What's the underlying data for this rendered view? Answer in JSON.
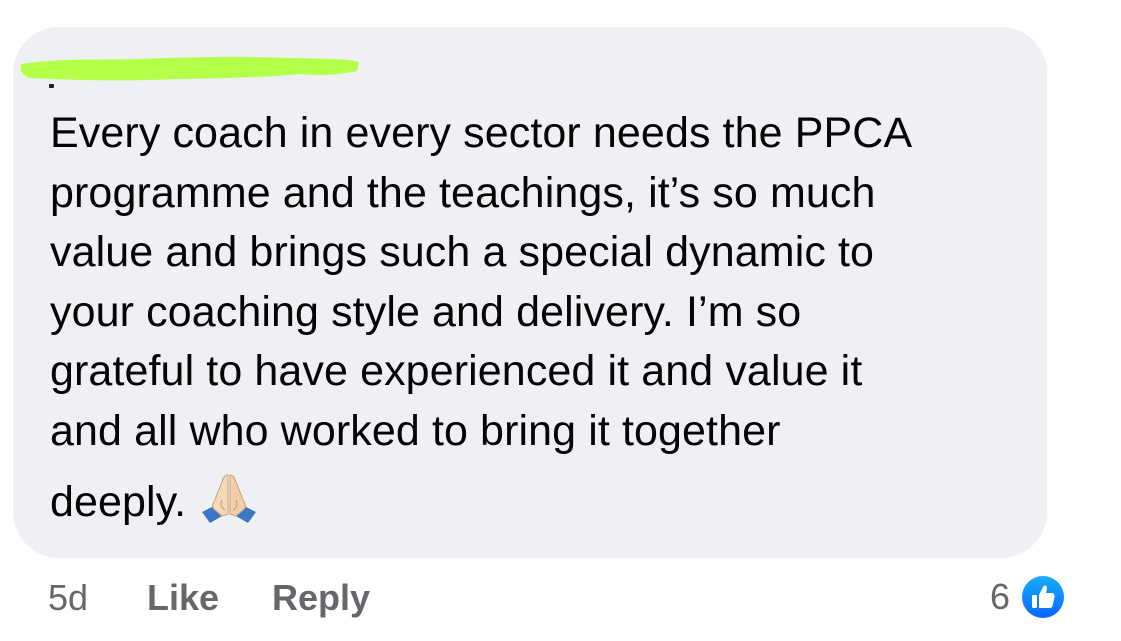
{
  "comment": {
    "text_lines": [
      "Every coach in every sector needs the PPCA",
      "programme and the teachings, it’s so much",
      "value and brings such a special dynamic to",
      "your coaching style and delivery. I’m so",
      "grateful to have experienced it and value it",
      "and all who worked to bring it together",
      "deeply."
    ],
    "emoji": "folded-hands",
    "redaction_color": "#b3ff4a",
    "bubble_color": "#eff0f3"
  },
  "meta": {
    "time": "5d",
    "like_label": "Like",
    "reply_label": "Reply"
  },
  "reactions": {
    "count": "6",
    "type": "like-icon",
    "color": "#1877f2"
  }
}
